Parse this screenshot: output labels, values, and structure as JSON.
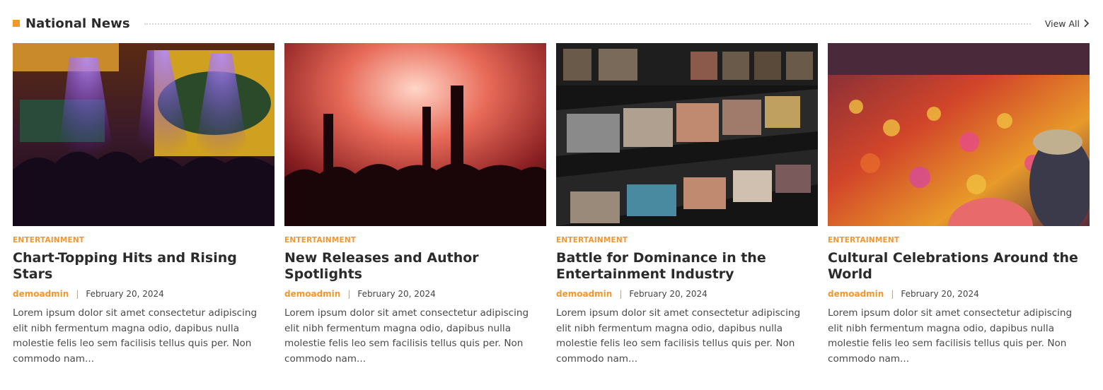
{
  "section": {
    "title": "National News",
    "view_all": "View All",
    "accent_color": "#f0972f"
  },
  "cards": [
    {
      "image": "concert-stage-pablo-sign",
      "category": "ENTERTAINMENT",
      "title": "Chart-Topping Hits and Rising Stars",
      "author": "demoadmin",
      "separator": "|",
      "date": "February 20, 2024",
      "excerpt": "Lorem ipsum dolor sit amet consectetur adipiscing elit nibh fermentum magna odio, dapibus nulla molestie felis leo sem facilisis tellus quis per. Non commodo nam..."
    },
    {
      "image": "concert-crowd-red-smoke",
      "category": "ENTERTAINMENT",
      "title": "New Releases and Author Spotlights",
      "author": "demoadmin",
      "separator": "|",
      "date": "February 20, 2024",
      "excerpt": "Lorem ipsum dolor sit amet consectetur adipiscing elit nibh fermentum magna odio, dapibus nulla molestie felis leo sem facilisis tellus quis per. Non commodo nam..."
    },
    {
      "image": "record-store-shelves",
      "category": "ENTERTAINMENT",
      "title": "Battle for Dominance in the Entertainment Industry",
      "author": "demoadmin",
      "separator": "|",
      "date": "February 20, 2024",
      "excerpt": "Lorem ipsum dolor sit amet consectetur adipiscing elit nibh fermentum magna odio, dapibus nulla molestie felis leo sem facilisis tellus quis per. Non commodo nam..."
    },
    {
      "image": "holi-festival-crowd",
      "category": "ENTERTAINMENT",
      "title": "Cultural Celebrations Around the World",
      "author": "demoadmin",
      "separator": "|",
      "date": "February 20, 2024",
      "excerpt": "Lorem ipsum dolor sit amet consectetur adipiscing elit nibh fermentum magna odio, dapibus nulla molestie felis leo sem facilisis tellus quis per. Non commodo nam..."
    }
  ]
}
